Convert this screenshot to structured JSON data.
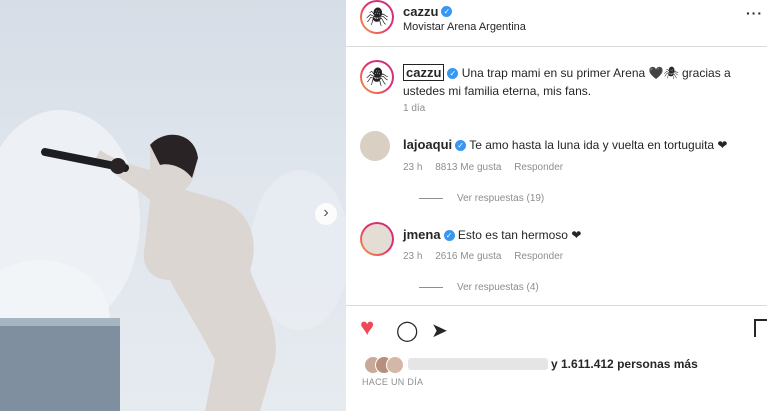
{
  "header": {
    "username": "cazzu",
    "location": "Movistar Arena Argentina",
    "more": "···"
  },
  "caption": {
    "username": "cazzu",
    "text": "Una trap mami en su primer Arena 🖤🕷 gracias a ustedes mi familia eterna, mis fans.",
    "time": "1 día"
  },
  "comments": [
    {
      "username": "lajoaqui",
      "text": "Te amo hasta la luna ida y vuelta en tortuguita ❤",
      "time": "23 h",
      "likes": "8813 Me gusta",
      "reply": "Responder",
      "replies": "Ver respuestas (19)"
    },
    {
      "username": "jmena",
      "text": "Esto es tan hermoso ❤",
      "time": "23 h",
      "likes": "2616 Me gusta",
      "reply": "Responder",
      "replies": "Ver respuestas (4)"
    }
  ],
  "actions": {
    "like": "♥",
    "comment": "◯",
    "share": "➤"
  },
  "likes_summary": {
    "text": "y 1.611.412 personas más"
  },
  "post_time": "HACE UN DÍA",
  "carousel_next": "›",
  "colors": {
    "verified": "#3897f0",
    "heart": "#ed4956"
  }
}
